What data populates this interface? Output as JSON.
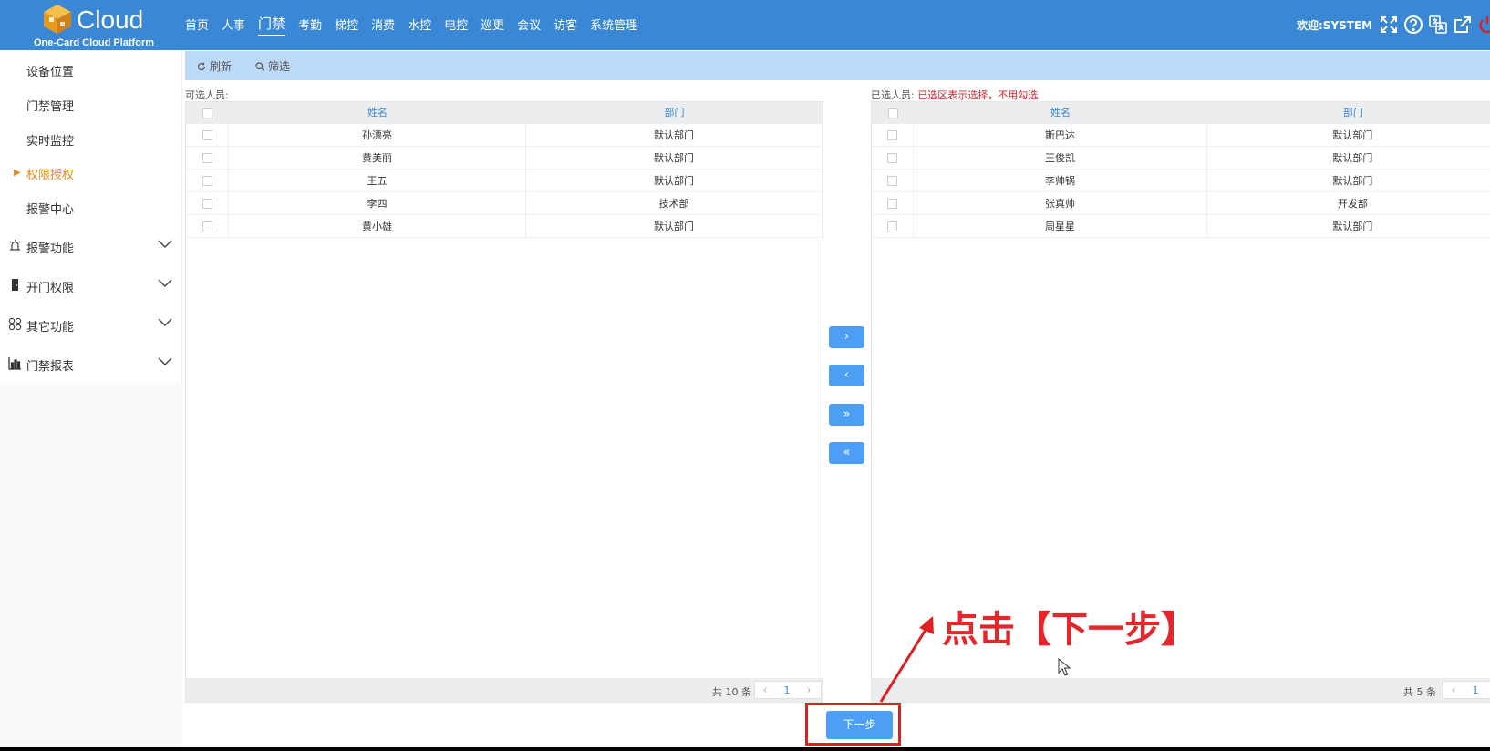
{
  "brand": {
    "name": "Cloud",
    "subtitle": "One-Card Cloud Platform"
  },
  "nav": {
    "items": [
      "首页",
      "人事",
      "门禁",
      "考勤",
      "梯控",
      "消费",
      "水控",
      "电控",
      "巡更",
      "会议",
      "访客",
      "系统管理"
    ],
    "active": "门禁"
  },
  "header": {
    "welcome": "欢迎:SYSTEM",
    "icons": [
      "fullscreen-icon",
      "help-icon",
      "translate-icon",
      "external-link-icon",
      "power-icon"
    ]
  },
  "sidebar": {
    "sub_items": [
      "设备位置",
      "门禁管理",
      "实时监控",
      "权限授权",
      "报警中心"
    ],
    "active_sub": "权限授权",
    "groups": [
      {
        "label": "报警功能",
        "icon": "alarm-icon"
      },
      {
        "label": "开门权限",
        "icon": "door-icon"
      },
      {
        "label": "其它功能",
        "icon": "grid-icon"
      },
      {
        "label": "门禁报表",
        "icon": "report-chart-icon"
      }
    ]
  },
  "toolbar": {
    "refresh_label": "刷新",
    "filter_label": "筛选"
  },
  "left_panel": {
    "title": "可选人员:",
    "columns": [
      "姓名",
      "部门"
    ],
    "rows": [
      {
        "name": "孙漂亮",
        "dept": "默认部门"
      },
      {
        "name": "黄美丽",
        "dept": "默认部门"
      },
      {
        "name": "王五",
        "dept": "默认部门"
      },
      {
        "name": "李四",
        "dept": "技术部"
      },
      {
        "name": "黄小雄",
        "dept": "默认部门"
      }
    ],
    "total": "共 10 条",
    "page": "1"
  },
  "right_panel": {
    "title": "已选人员:",
    "hint": "已选区表示选择，不用勾选",
    "columns": [
      "姓名",
      "部门"
    ],
    "rows": [
      {
        "name": "斯巴达",
        "dept": "默认部门"
      },
      {
        "name": "王俊凯",
        "dept": "默认部门"
      },
      {
        "name": "李帅锅",
        "dept": "默认部门"
      },
      {
        "name": "张真帅",
        "dept": "开发部"
      },
      {
        "name": "周星星",
        "dept": "默认部门"
      }
    ],
    "total": "共 5 条",
    "page": "1"
  },
  "transfer": {
    "move_right": "›",
    "move_left": "‹",
    "move_all_right": "»",
    "move_all_left": "«"
  },
  "pager": {
    "prev": "‹",
    "next": "›"
  },
  "next_button_label": "下一步",
  "annotation": "点击【下一步】",
  "colors": {
    "header_bg": "#3a87d6",
    "toolbar_bg": "#bcdaf7",
    "button": "#4c9ff5",
    "active_side": "#e88a1a",
    "annotation": "#e6262b"
  }
}
